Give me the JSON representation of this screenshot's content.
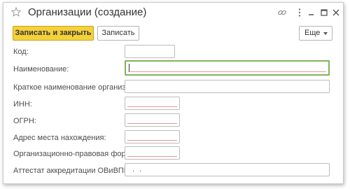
{
  "window": {
    "title": "Организации (создание)",
    "buttons": [
      "link-icon",
      "more-vert-icon",
      "minimize-icon",
      "maximize-icon",
      "close-icon"
    ]
  },
  "toolbar": {
    "save_close_label": "Записать и закрыть",
    "save_label": "Записать",
    "more_label": "Еще"
  },
  "form": {
    "code": {
      "label": "Код:",
      "value": ""
    },
    "name": {
      "label": "Наименование:",
      "value": ""
    },
    "short_name": {
      "label": "Краткое наименование организации:",
      "value": ""
    },
    "inn": {
      "label": "ИНН:",
      "value": ""
    },
    "ogrn": {
      "label": "ОГРН:",
      "value": ""
    },
    "address": {
      "label": "Адрес места нахождения:",
      "value": ""
    },
    "legal_form": {
      "label": "Организационно-правовая форма:",
      "value": ""
    },
    "attestat": {
      "label": "Аттестат аккредитации ОВиВПГ:",
      "value": ". ."
    }
  },
  "colors": {
    "primary_button": "#f5d13a",
    "focus_border": "#7fb55a",
    "required_underline": "#e79898"
  }
}
